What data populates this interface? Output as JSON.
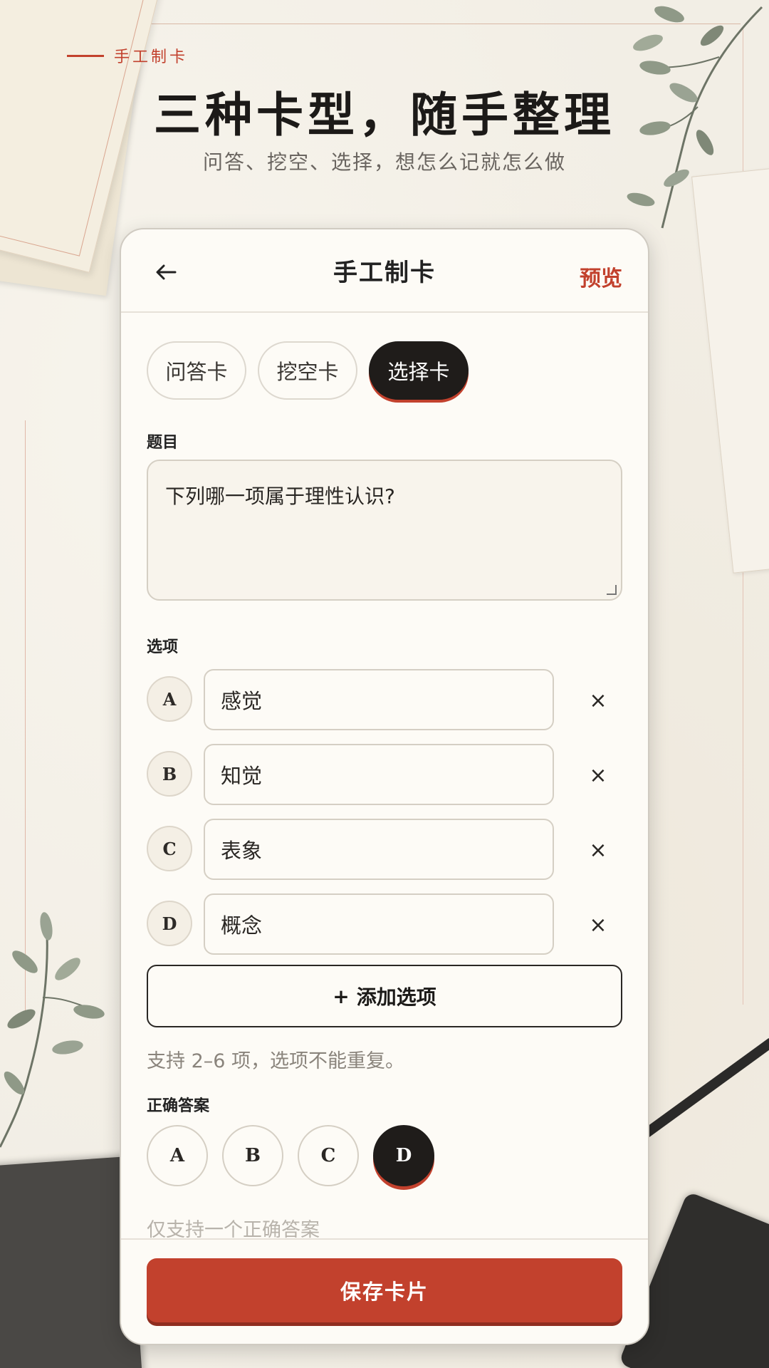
{
  "header": {
    "eyebrow": "手工制卡",
    "title": "三种卡型，随手整理",
    "subtitle": "问答、挖空、选择，想怎么记就怎么做"
  },
  "appbar": {
    "title": "手工制卡",
    "preview_label": "预览",
    "back_icon": "arrow-left-icon"
  },
  "tabs": [
    {
      "label": "问答卡",
      "active": false
    },
    {
      "label": "挖空卡",
      "active": false
    },
    {
      "label": "选择卡",
      "active": true
    }
  ],
  "question": {
    "label": "题目",
    "value": "下列哪一项属于理性认识?"
  },
  "options": {
    "label": "选项",
    "items": [
      {
        "letter": "A",
        "value": "感觉"
      },
      {
        "letter": "B",
        "value": "知觉"
      },
      {
        "letter": "C",
        "value": "表象"
      },
      {
        "letter": "D",
        "value": "概念"
      }
    ],
    "remove_glyph": "×",
    "add_label": "添加选项",
    "add_glyph": "+",
    "hint": "支持 2–6 项，选项不能重复。"
  },
  "answer": {
    "label": "正确答案",
    "choices": [
      "A",
      "B",
      "C",
      "D"
    ],
    "selected": "D",
    "hint_partial": "仅支持一个正确答案"
  },
  "footer": {
    "save_label": "保存卡片"
  },
  "colors": {
    "accent": "#c2412d",
    "dark": "#1f1c1a",
    "paper": "#fdfbf6"
  }
}
